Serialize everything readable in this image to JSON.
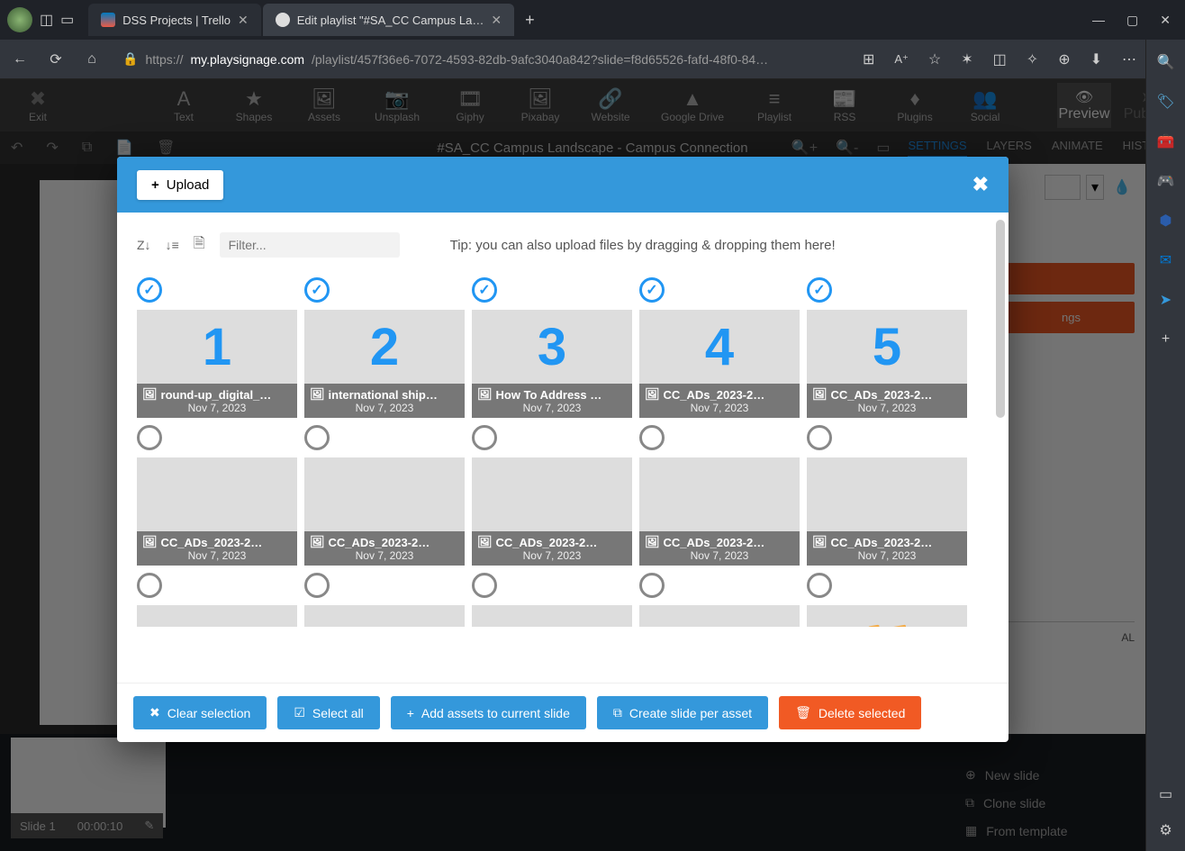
{
  "browser": {
    "tabs": [
      {
        "title": "DSS Projects | Trello",
        "active": false
      },
      {
        "title": "Edit playlist \"#SA_CC Campus La…",
        "active": true
      }
    ],
    "url_prefix": "https://",
    "url_host": "my.playsignage.com",
    "url_path": "/playlist/457f36e6-7072-4593-82db-9afc3040a842?slide=f8d65526-fafd-48f0-84…"
  },
  "app": {
    "exit": "Exit",
    "tools": [
      "Text",
      "Shapes",
      "Assets",
      "Unsplash",
      "Giphy",
      "Pixabay",
      "Website",
      "Google Drive",
      "Playlist",
      "RSS",
      "Plugins",
      "Social"
    ],
    "preview": "Preview",
    "publish": "Publish",
    "doc_title": "#SA_CC Campus Landscape - Campus Connection",
    "tabs": [
      "SETTINGS",
      "LAYERS",
      "ANIMATE",
      "HISTORY"
    ],
    "orange2": "ngs",
    "bottom": {
      "slide_label": "Slide 1",
      "time": "00:00:10",
      "new_slide": "New slide",
      "clone_slide": "Clone slide",
      "from_template": "From template",
      "al_label": "AL"
    }
  },
  "modal": {
    "upload": "Upload",
    "filter_placeholder": "Filter...",
    "tip": "Tip: you can also upload files by dragging & dropping them here!",
    "footer": {
      "clear": "Clear selection",
      "select_all": "Select all",
      "add_assets": "Add assets to current slide",
      "create_per_asset": "Create slide per asset",
      "delete_selected": "Delete selected"
    },
    "assets": [
      {
        "name": "round-up_digital_…",
        "date": "Nov 7, 2023",
        "checked": true,
        "num": "1",
        "th": "th1"
      },
      {
        "name": "international ship…",
        "date": "Nov 7, 2023",
        "checked": true,
        "num": "2",
        "th": "th2"
      },
      {
        "name": "How To Address …",
        "date": "Nov 7, 2023",
        "checked": true,
        "num": "3",
        "th": "th3"
      },
      {
        "name": "CC_ADs_2023-2…",
        "date": "Nov 7, 2023",
        "checked": true,
        "num": "4",
        "th": "th4"
      },
      {
        "name": "CC_ADs_2023-2…",
        "date": "Nov 7, 2023",
        "checked": true,
        "num": "5",
        "th": "th5"
      },
      {
        "name": "CC_ADs_2023-2…",
        "date": "Nov 7, 2023",
        "checked": false,
        "th": "th6"
      },
      {
        "name": "CC_ADs_2023-2…",
        "date": "Nov 7, 2023",
        "checked": false,
        "th": "th7"
      },
      {
        "name": "CC_ADs_2023-2…",
        "date": "Nov 7, 2023",
        "checked": false,
        "th": "th8"
      },
      {
        "name": "CC_ADs_2023-2…",
        "date": "Nov 7, 2023",
        "checked": false,
        "th": "th9"
      },
      {
        "name": "CC_ADs_2023-2…",
        "date": "Nov 7, 2023",
        "checked": false,
        "th": "th10"
      },
      {
        "name": "",
        "date": "",
        "checked": false,
        "th": "th11",
        "partial": true
      },
      {
        "name": "",
        "date": "",
        "checked": false,
        "th": "th12",
        "partial": true
      },
      {
        "name": "",
        "date": "",
        "checked": false,
        "th": "th13",
        "partial": true
      },
      {
        "name": "",
        "date": "",
        "checked": false,
        "th": "th14",
        "partial": true
      },
      {
        "name": "",
        "date": "",
        "checked": false,
        "folder": true,
        "partial": true
      }
    ]
  }
}
